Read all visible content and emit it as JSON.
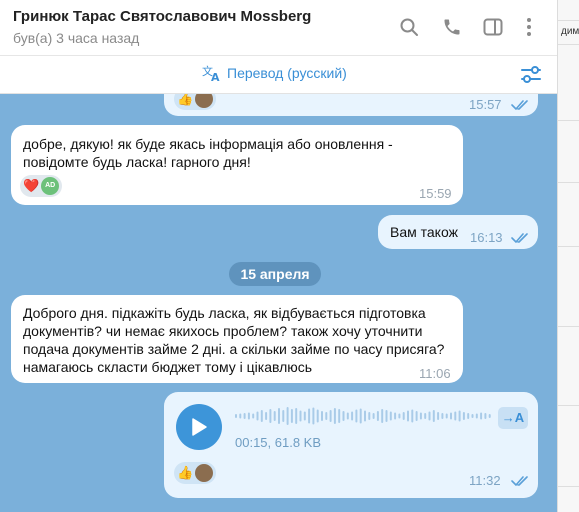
{
  "header": {
    "contact_name": "Гринюк Тарас Святославович Mossberg",
    "status": "був(а) 3 часа назад",
    "icons": [
      "search-icon",
      "phone-icon",
      "sidebar-toggle-icon",
      "more-vert-icon"
    ]
  },
  "translate_bar": {
    "label": "Перевод (русский)",
    "icon": "translate-icon",
    "settings_icon": "settings-sliders-icon"
  },
  "right_strip": {
    "text": "димо"
  },
  "messages": [
    {
      "direction": "out",
      "time": "15:57",
      "reactions": [
        "👍",
        "avatar"
      ],
      "status": "read",
      "partially_visible": true
    },
    {
      "direction": "in",
      "text": "добре, дякую! як буде якась інформація або оновлення - повідомте будь ласка! гарного дня!",
      "time": "15:59",
      "reactions": [
        "❤️",
        "AD"
      ]
    },
    {
      "direction": "out",
      "text": "Вам також",
      "time": "16:13",
      "status": "read"
    },
    {
      "type": "date_separator",
      "text": "15 апреля"
    },
    {
      "direction": "in",
      "text": "Доброго дня. підкажіть будь ласка, як відбувається підготовка документів? чи немає якихось проблем? також хочу уточнити подача документів займе 2 дні. а скільки займе по часу присяга? намагаюсь скласти бюджет тому і цікавлюсь",
      "time": "11:06"
    },
    {
      "direction": "out",
      "type": "voice",
      "duration": "00:15",
      "size": "61.8 KB",
      "meta": "00:15, 61.8 KB",
      "transcribe_label": "→A",
      "time": "11:32",
      "reactions": [
        "👍",
        "avatar"
      ],
      "status": "read"
    }
  ],
  "colors": {
    "chat_background": "#7bb0da",
    "incoming_bubble": "#ffffff",
    "outgoing_bubble": "#e8f4fe",
    "accent": "#3a8fd6",
    "date_chip": "#5f93bd"
  }
}
